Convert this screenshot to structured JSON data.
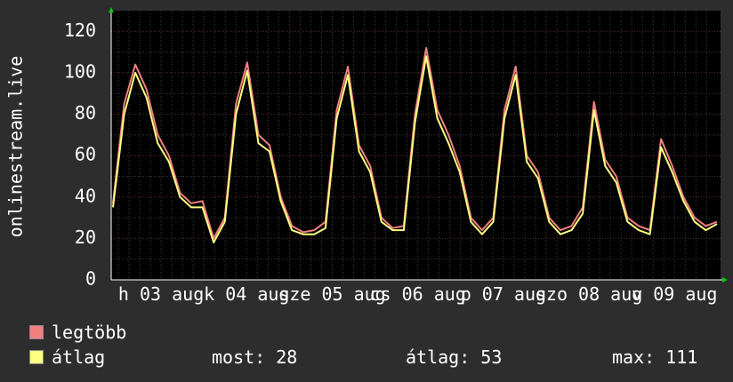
{
  "chart_data": {
    "type": "line",
    "ylabel": "onlinestream.live",
    "ylim": [
      0,
      130
    ],
    "yticks": [
      0,
      20,
      40,
      60,
      80,
      100,
      120
    ],
    "grid": true,
    "day_labels": [
      "h 03 aug",
      "k 04 aug",
      "sze 05 aug",
      "cs 06 aug",
      "p 07 aug",
      "szo 08 aug",
      "v 09 aug"
    ],
    "day_peaks": [
      104,
      105,
      103,
      112,
      103,
      88,
      70
    ],
    "series": [
      {
        "name": "legtöbb",
        "color": "#f08080",
        "values": [
          37,
          85,
          104,
          92,
          70,
          60,
          42,
          37,
          38,
          20,
          30,
          85,
          105,
          70,
          65,
          40,
          26,
          23,
          24,
          28,
          82,
          103,
          65,
          55,
          30,
          25,
          26,
          80,
          112,
          82,
          70,
          55,
          30,
          24,
          30,
          82,
          103,
          60,
          52,
          30,
          24,
          26,
          35,
          86,
          58,
          50,
          30,
          26,
          24,
          68,
          55,
          40,
          30,
          26,
          28
        ]
      },
      {
        "name": "átlag",
        "color": "#ffff80",
        "values": [
          35,
          80,
          100,
          88,
          66,
          57,
          40,
          35,
          35,
          18,
          28,
          80,
          101,
          66,
          62,
          38,
          24,
          22,
          22,
          25,
          78,
          99,
          62,
          52,
          28,
          24,
          24,
          76,
          108,
          78,
          66,
          52,
          28,
          22,
          28,
          78,
          99,
          57,
          49,
          28,
          22,
          24,
          32,
          82,
          55,
          47,
          28,
          24,
          22,
          64,
          52,
          38,
          28,
          24,
          27
        ]
      }
    ]
  },
  "legend": {
    "items": [
      {
        "label": "legtöbb",
        "color": "#f08080"
      },
      {
        "label": "átlag",
        "color": "#ffff80"
      }
    ],
    "stats": {
      "now": "most: 28",
      "avg": "átlag: 53",
      "max": "max: 111"
    }
  }
}
